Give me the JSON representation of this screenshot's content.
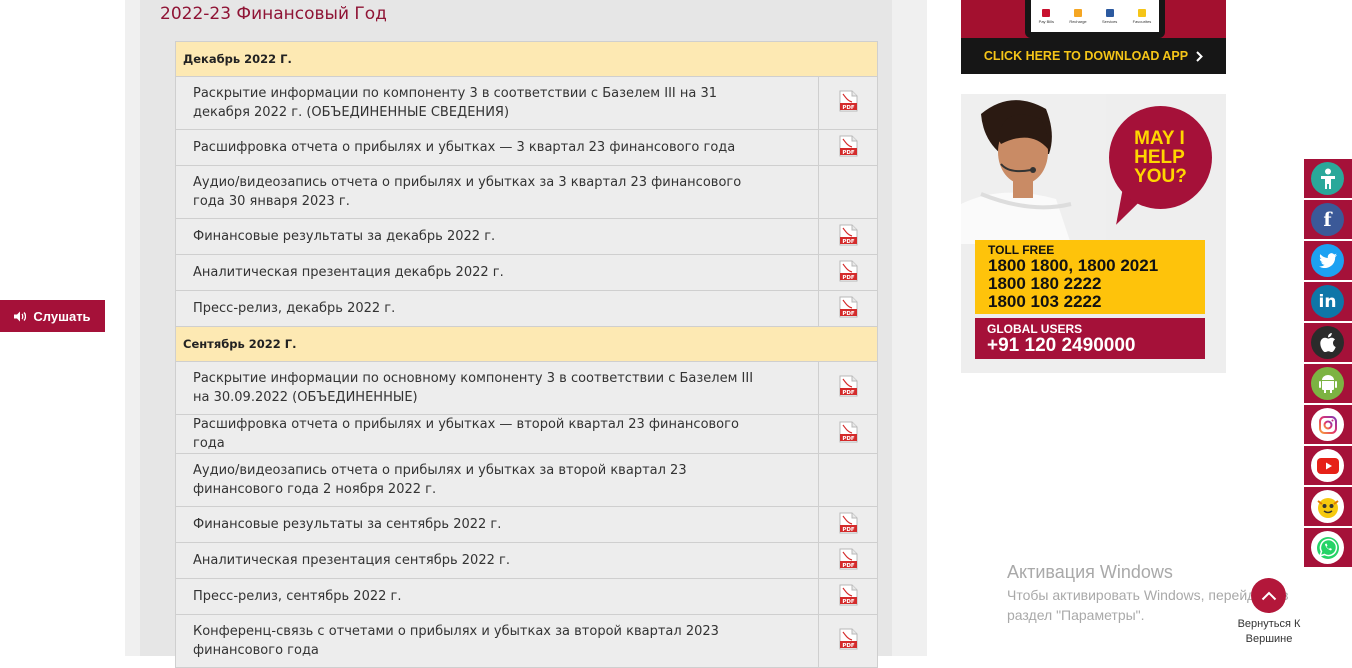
{
  "fiscal_year_title": "2022-23 Финансовый Год",
  "sections": [
    {
      "heading": "Декабрь 2022 Г.",
      "items": [
        {
          "title": "Раскрытие информации по компоненту 3 в соответствии с Базелем III на 31 декабря 2022 г. (ОБЪЕДИНЕННЫЕ СВЕДЕНИЯ)",
          "pdf": true
        },
        {
          "title": "Расшифровка отчета о прибылях и убытках — 3 квартал 23 финансового года",
          "pdf": true
        },
        {
          "title": "Аудио/видеозапись отчета о прибылях и убытках за 3 квартал 23 финансового года 30 января 2023 г.",
          "pdf": false
        },
        {
          "title": "Финансовые результаты за декабрь 2022 г.",
          "pdf": true
        },
        {
          "title": "Аналитическая презентация декабрь 2022 г.",
          "pdf": true
        },
        {
          "title": "Пресс-релиз, декабрь 2022 г.",
          "pdf": true
        }
      ]
    },
    {
      "heading": "Сентябрь 2022 Г.",
      "items": [
        {
          "title": "Раскрытие информации по основному компоненту 3 в соответствии с Базелем III на 30.09.2022 (ОБЪЕДИНЕННЫЕ)",
          "pdf": true
        },
        {
          "title": "Расшифровка отчета о прибылях и убытках — второй квартал 23 финансового года",
          "pdf": true
        },
        {
          "title": "Аудио/видеозапись отчета о прибылях и убытках за второй квартал 23 финансового года 2 ноября 2022 г.",
          "pdf": false
        },
        {
          "title": "Финансовые результаты за сентябрь 2022 г.",
          "pdf": true
        },
        {
          "title": "Аналитическая презентация сентябрь 2022 г.",
          "pdf": true
        },
        {
          "title": "Пресс-релиз, сентябрь 2022 г.",
          "pdf": true
        },
        {
          "title": "Конференц-связь с отчетами о прибылях и убытках за второй квартал 2023 финансового года",
          "pdf": true
        }
      ]
    }
  ],
  "listen_button": "Слушать",
  "app_banner": {
    "tiles": [
      "Pay Bills",
      "Recharge",
      "Services",
      "Favourites"
    ],
    "cta": "CLICK HERE TO DOWNLOAD APP"
  },
  "help_banner": {
    "bubble_lines": [
      "MAY I",
      "HELP",
      "YOU?"
    ],
    "toll_free_label": "TOLL FREE",
    "toll_free_numbers": [
      "1800 1800, 1800 2021",
      "1800 180 2222",
      "1800 103 2222"
    ],
    "global_label": "GLOBAL USERS",
    "global_number": "+91 120 2490000"
  },
  "social_links": [
    {
      "name": "accessibility",
      "icon": "accessibility-icon",
      "color": "#2aa89a"
    },
    {
      "name": "facebook",
      "icon": "facebook-icon",
      "color": "#3b5998"
    },
    {
      "name": "twitter",
      "icon": "twitter-icon",
      "color": "#1da1f2"
    },
    {
      "name": "linkedin",
      "icon": "linkedin-icon",
      "color": "#0e76a8"
    },
    {
      "name": "apple",
      "icon": "apple-icon",
      "color": "#2b2b2b"
    },
    {
      "name": "android",
      "icon": "android-icon",
      "color": "#7cb342"
    },
    {
      "name": "instagram",
      "icon": "instagram-icon",
      "color": "#ffffff"
    },
    {
      "name": "youtube",
      "icon": "youtube-icon",
      "color": "#ffffff"
    },
    {
      "name": "chatbot",
      "icon": "chatbot-icon",
      "color": "#ffffff"
    },
    {
      "name": "whatsapp",
      "icon": "whatsapp-icon",
      "color": "#ffffff"
    }
  ],
  "windows_watermark": {
    "title": "Активация Windows",
    "subtitle": "Чтобы активировать Windows, перейдите в раздел \"Параметры\"."
  },
  "back_to_top": "Вернуться К Вершине",
  "colors": {
    "brand": "#a51139",
    "section_bg": "#fde9b3",
    "title": "#8f1435",
    "toll_bg": "#fec30b"
  }
}
